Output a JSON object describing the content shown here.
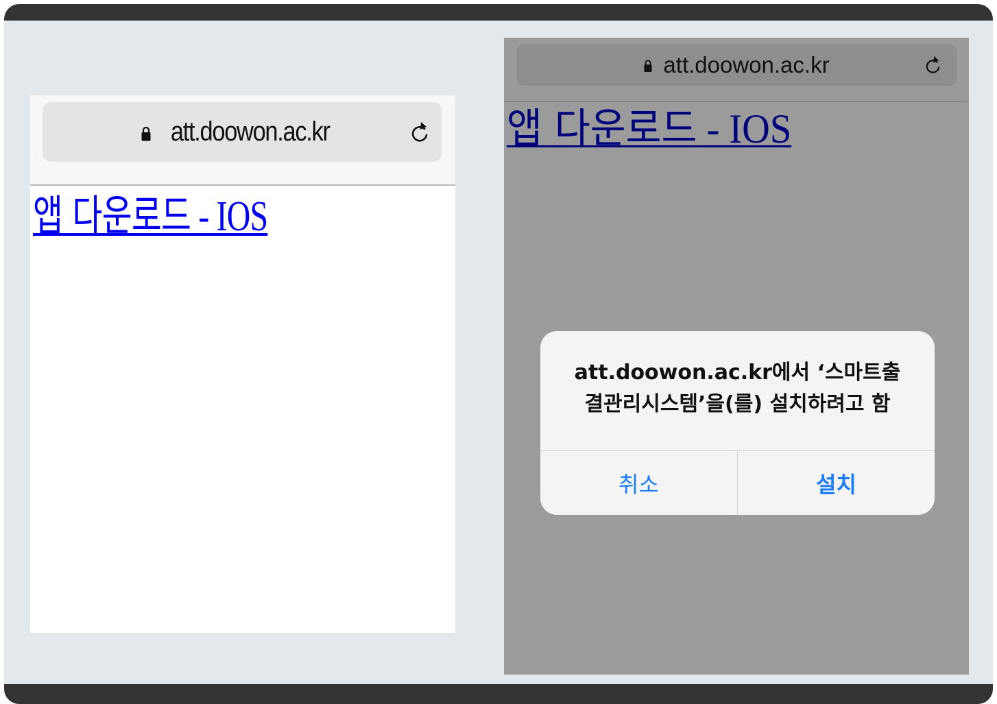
{
  "left_screen": {
    "url": "att.doowon.ac.kr",
    "link_text_ko": "앱 다운로드",
    "link_text_latin": " - IOS",
    "icons": {
      "lock": "lock-icon",
      "reload": "reload-icon"
    }
  },
  "right_screen": {
    "url": "att.doowon.ac.kr",
    "link_text_ko": "앱 다운로드",
    "link_text_latin": " - IOS",
    "icons": {
      "lock": "lock-icon",
      "reload": "reload-icon"
    },
    "dialog": {
      "message_line1": "att.doowon.ac.kr에서 ‘스마트출",
      "message_line2": "결관리시스템’을(를) 설치하려고 함",
      "cancel_label": "취소",
      "install_label": "설치"
    }
  },
  "colors": {
    "link_blue": "#0000ee",
    "dimmed_link": "#00007c",
    "ios_blue": "#1a7cf6",
    "frame_dark": "#333333",
    "canvas": "#e3e8ec"
  }
}
